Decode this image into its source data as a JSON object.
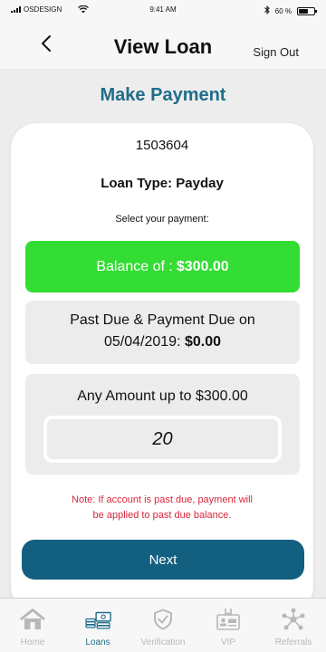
{
  "status_bar": {
    "carrier": "OSDESIGN",
    "time": "9:41 AM",
    "battery": "60 %",
    "battery_level": 0.6
  },
  "header": {
    "title": "View Loan",
    "sign_out": "Sign Out"
  },
  "section_title": "Make Payment",
  "loan": {
    "number": "1503604",
    "type_label": "Loan Type: Payday"
  },
  "select_label": "Select your payment:",
  "options": {
    "balance": {
      "prefix": "Balance of :",
      "amount": "$300.00"
    },
    "past_due": {
      "line1": "Past Due & Payment Due on",
      "line2_prefix": "05/04/2019:",
      "amount": "$0.00"
    },
    "any_amount": {
      "label": "Any Amount up to $300.00",
      "value": "20"
    }
  },
  "note": {
    "line1": "Note: If account is past due, payment will",
    "line2": "be applied to past due balance."
  },
  "next_label": "Next",
  "tabs": [
    {
      "label": "Home",
      "icon": "home-icon"
    },
    {
      "label": "Loans",
      "icon": "loans-icon"
    },
    {
      "label": "Verification",
      "icon": "shield-check-icon"
    },
    {
      "label": "VIP",
      "icon": "vip-badge-icon"
    },
    {
      "label": "Referrals",
      "icon": "network-icon"
    }
  ],
  "colors": {
    "accent": "#1f6c8b",
    "next_button": "#135f80",
    "balance_option": "#33dd33",
    "note": "#d8263a",
    "inactive_tab": "#b8b8b8"
  }
}
